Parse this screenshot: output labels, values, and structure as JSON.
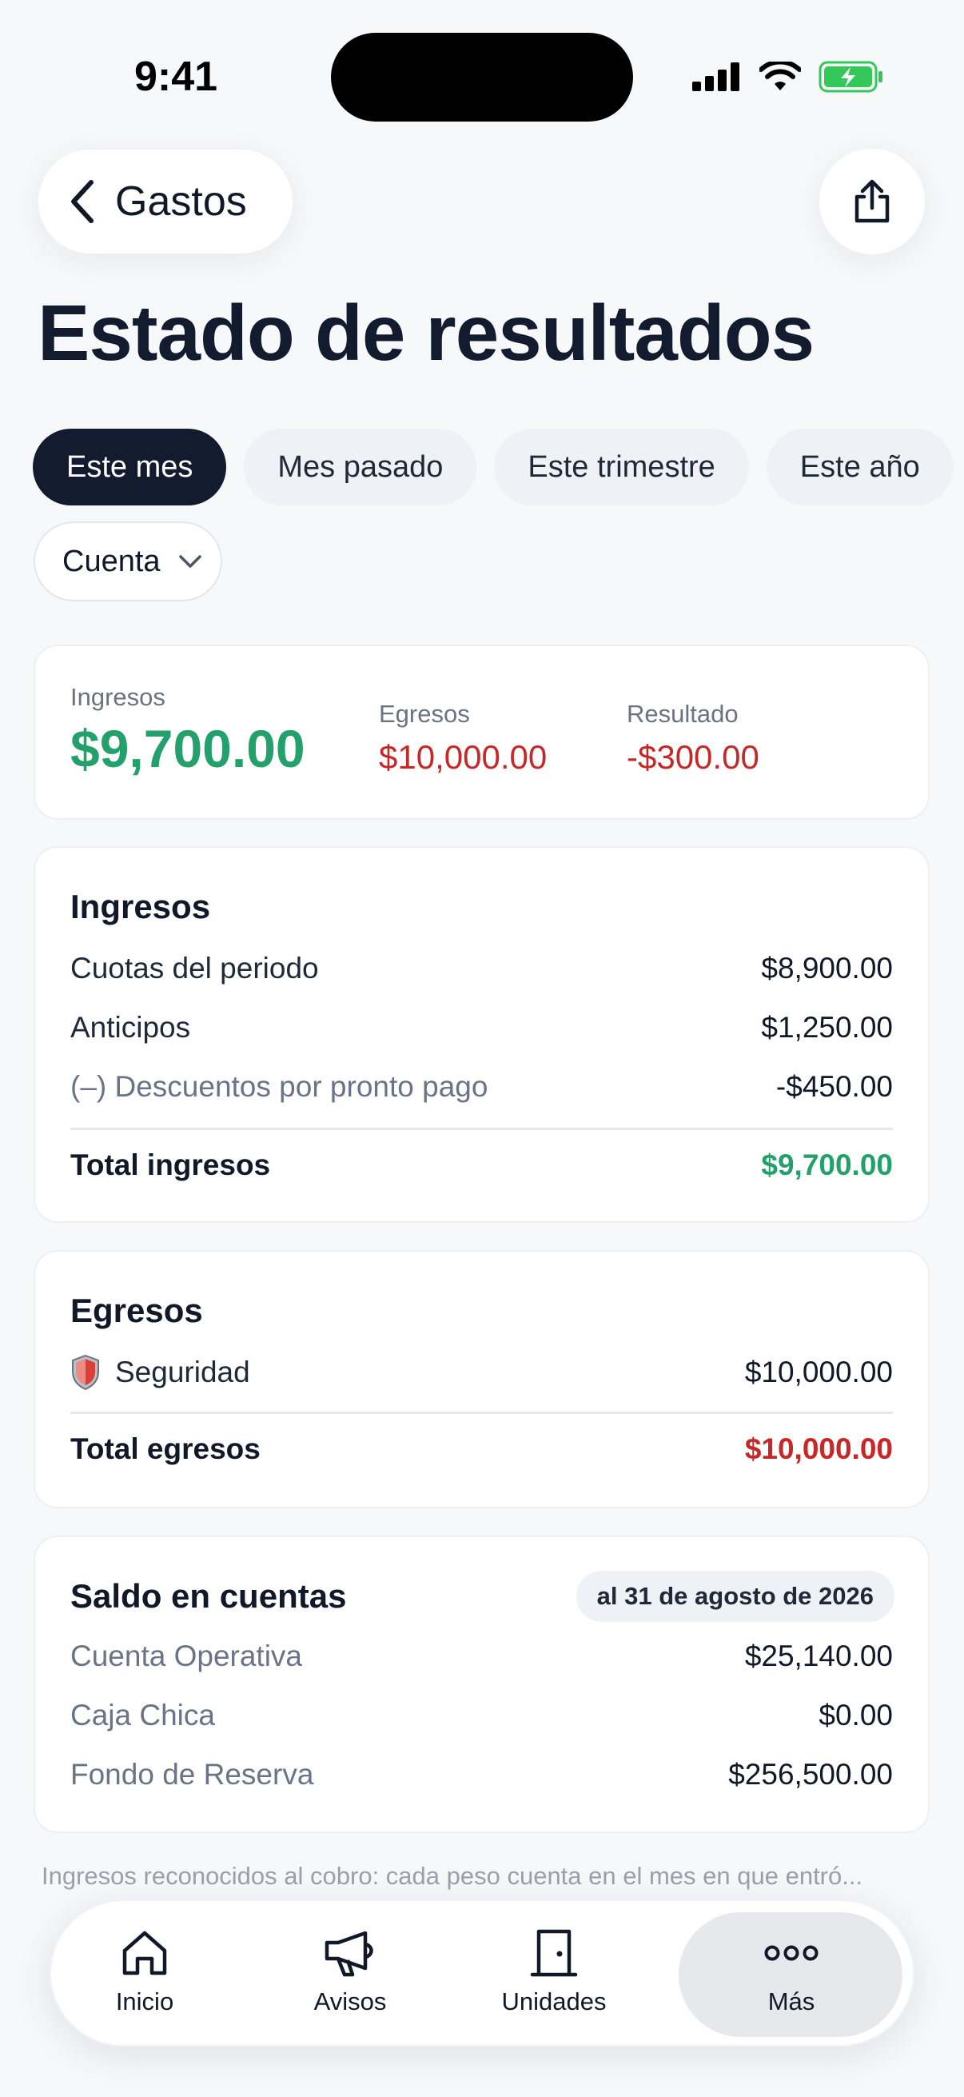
{
  "status": {
    "time": "9:41"
  },
  "header": {
    "back_label": "Gastos",
    "title": "Estado de resultados"
  },
  "filters": {
    "periods": [
      "Este mes",
      "Mes pasado",
      "Este trimestre",
      "Este año"
    ],
    "selected": "Este mes",
    "account_label": "Cuenta"
  },
  "summary": {
    "ingresos_label": "Ingresos",
    "ingresos_value": "$9,700.00",
    "egresos_label": "Egresos",
    "egresos_value": "$10,000.00",
    "resultado_label": "Resultado",
    "resultado_value": "-$300.00"
  },
  "ingresos": {
    "title": "Ingresos",
    "rows": [
      {
        "label": "Cuotas del periodo",
        "amount": "$8,900.00"
      },
      {
        "label": "Anticipos",
        "amount": "$1,250.00"
      },
      {
        "label": "(–) Descuentos por pronto pago",
        "amount": "-$450.00"
      }
    ],
    "total_label": "Total ingresos",
    "total_value": "$9,700.00"
  },
  "egresos": {
    "title": "Egresos",
    "rows": [
      {
        "label": "Seguridad",
        "amount": "$10,000.00",
        "icon": "shield-icon"
      }
    ],
    "total_label": "Total egresos",
    "total_value": "$10,000.00"
  },
  "saldo": {
    "title": "Saldo en cuentas",
    "date_badge": "al 31 de agosto de 2026",
    "rows": [
      {
        "label": "Cuenta Operativa",
        "amount": "$25,140.00"
      },
      {
        "label": "Caja Chica",
        "amount": "$0.00"
      },
      {
        "label": "Fondo de Reserva",
        "amount": "$256,500.00"
      }
    ]
  },
  "footnote": "Ingresos reconocidos al cobro: cada peso cuenta en el mes en que entró...",
  "tabbar": {
    "items": [
      {
        "label": "Inicio",
        "icon": "home-icon"
      },
      {
        "label": "Avisos",
        "icon": "megaphone-icon"
      },
      {
        "label": "Unidades",
        "icon": "door-icon"
      },
      {
        "label": "Más",
        "icon": "more-icon"
      }
    ],
    "active": "Más"
  },
  "colors": {
    "positive": "#23a06b",
    "negative": "#c62828",
    "dark": "#131b2e"
  }
}
